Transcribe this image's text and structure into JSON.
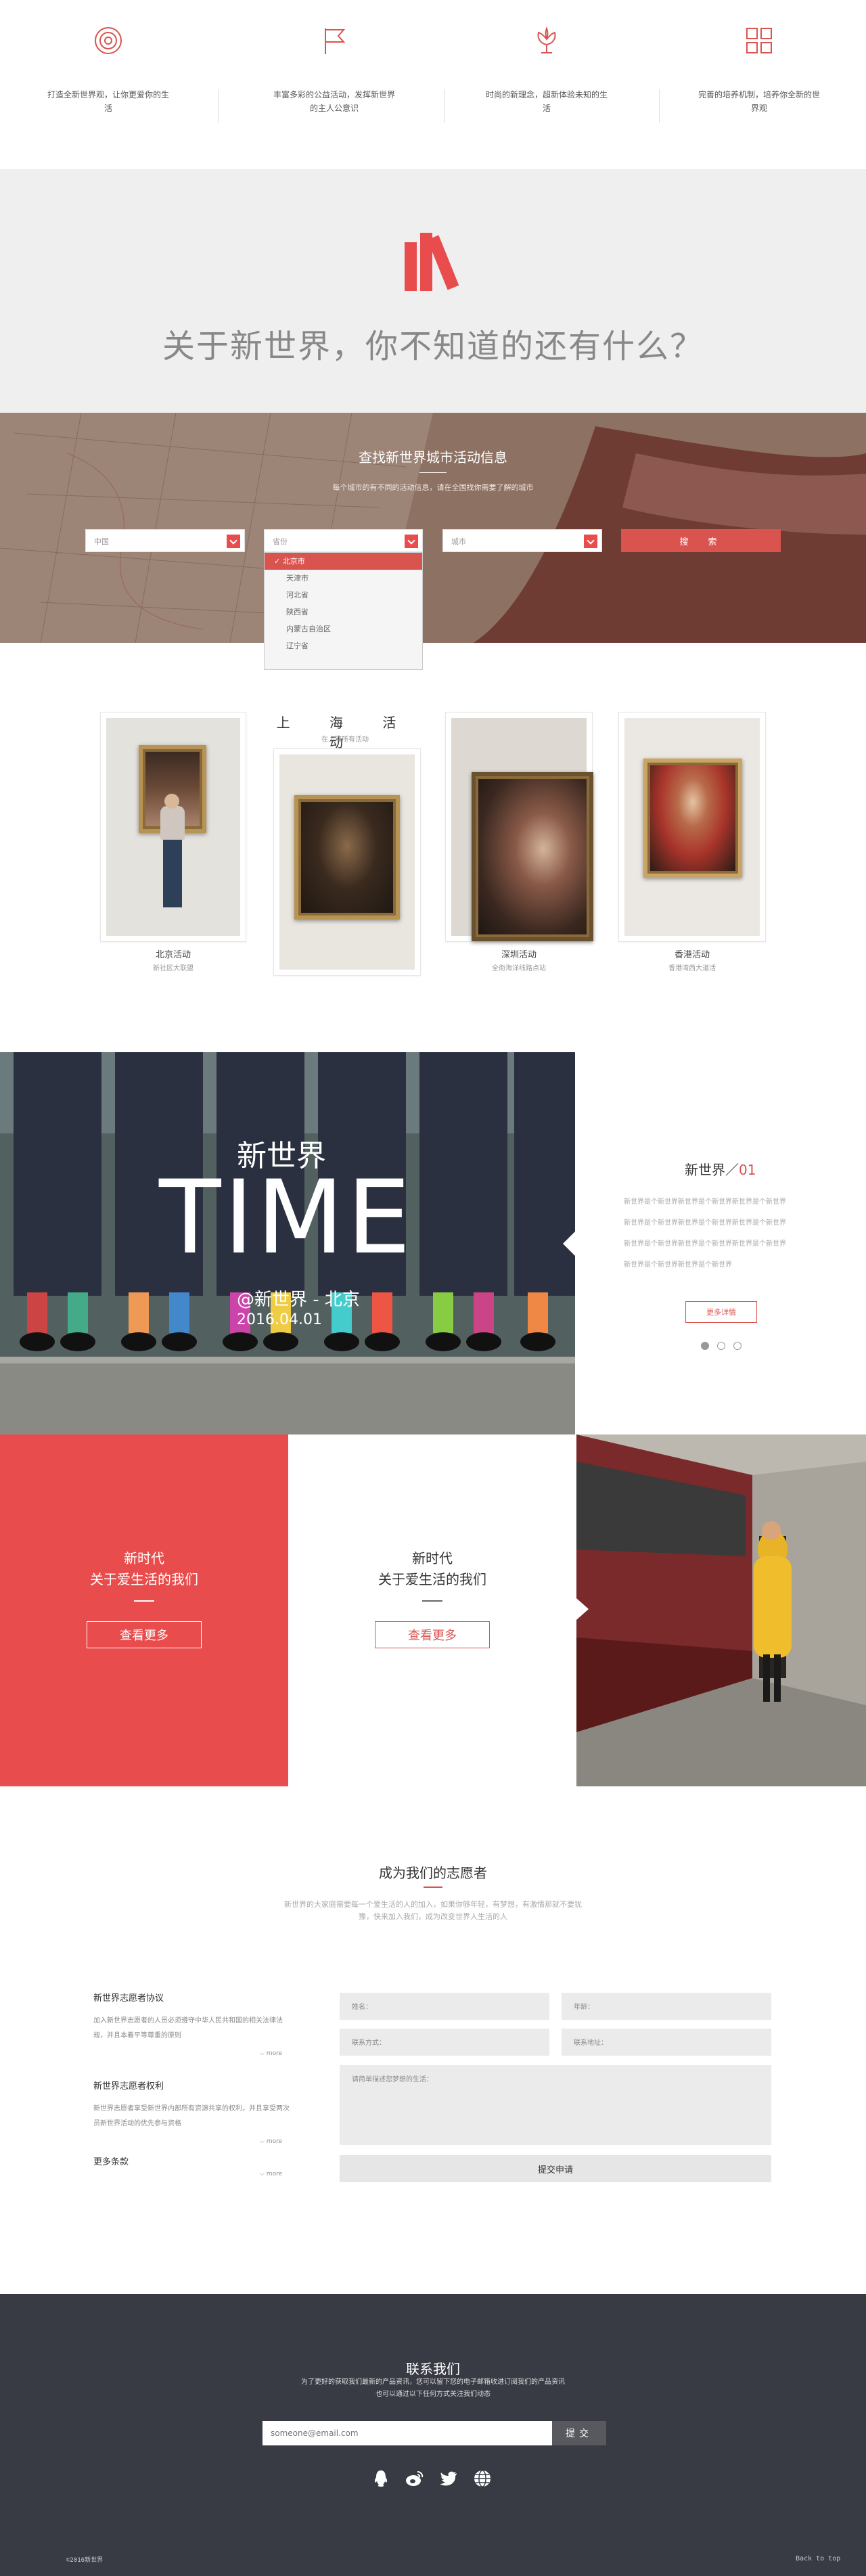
{
  "colors": {
    "accent": "#d9534f",
    "hero_bg": "#efefef",
    "footer_bg": "#383a44",
    "era_red": "#e84c4c"
  },
  "features": [
    {
      "icon": "target-icon",
      "text": "打造全新世界观，让你更爱你的生活"
    },
    {
      "icon": "flag-icon",
      "text": "丰富多彩的公益活动，发挥新世界的主人公意识"
    },
    {
      "icon": "lotus-icon",
      "text": "时尚的新理念，超新体验未知的生活"
    },
    {
      "icon": "grid-icon",
      "text": "完善的培养机制，培养你全新的世界观"
    }
  ],
  "about": {
    "icon": "books-icon",
    "title": "关于新世界，你不知道的还有什么？"
  },
  "search": {
    "title": "查找新世界城市活动信息",
    "subtitle": "每个城市的有不同的活动信息，请在全国找你需要了解的城市",
    "country": "中国",
    "province": "省份",
    "city": "城市",
    "button": "搜　索",
    "dropdown": [
      "北京市",
      "天津市",
      "河北省",
      "陕西省",
      "内蒙古自治区",
      "辽宁省"
    ]
  },
  "activity": {
    "title": "上 海 活 动",
    "subtitle": "在上海所有活动",
    "cards": [
      {
        "name": "北京活动",
        "place": "新社区大联盟"
      },
      {
        "name": "深圳活动",
        "place": "全街海洋线路点站"
      },
      {
        "name": "香港活动",
        "place": "香港湾西大道活"
      }
    ]
  },
  "time": {
    "small": "新世界",
    "big": "TIME",
    "location": "@新世界 - 北京",
    "date": "2016.04.01",
    "panel_title": "新世界／",
    "panel_num": "01",
    "panel_text": [
      "新世界是个新世界新世界是个新世界新世界是个新世界",
      "新世界是个新世界新世界是个新世界新世界是个新世界",
      "新世界是个新世界新世界是个新世界新世界是个新世界",
      "新世界是个新世界新世界是个新世界"
    ],
    "more": "更多详情"
  },
  "era": {
    "red": {
      "l1": "新时代",
      "l2": "关于爱生活的我们",
      "btn": "查看更多"
    },
    "white": {
      "l1": "新时代",
      "l2": "关于爱生活的我们",
      "btn": "查看更多"
    }
  },
  "volunteer": {
    "title": "成为我们的志愿者",
    "subtitle": "新世界的大家庭需要每一个爱生活的人的加入，如果你够年轻，有梦想，有激情那就不要犹豫，快来加入我们，成为改变世界人生活的人",
    "terms": [
      {
        "title": "新世界志愿者协议",
        "text": "加入新世界志愿者的人员必须遵守中华人民共和国的相关法律法规，并且本着平等尊重的原则",
        "more": "more"
      },
      {
        "title": "新世界志愿者权利",
        "text": "新世界志愿者享受新世界内部所有资源共享的权利，并且享受两次员新世界活动的优先参与资格",
        "more": "more"
      },
      {
        "title": "更多条款",
        "text": "",
        "more": "more"
      }
    ],
    "name": "姓名：",
    "age": "年龄：",
    "contact": "联系方式：",
    "address": "联系地址：",
    "message": "请简单描述您梦想的生活：",
    "submit": "提交申请"
  },
  "footer": {
    "title": "联系我们",
    "sub1": "为了更好的获取我们最新的产品资讯，您可以留下您的电子邮箱收进订阅我们的产品资讯",
    "sub2": "也可以通过以下任何方式关注我们动态",
    "email_placeholder": "someone@email.com",
    "send": "提交",
    "social": [
      "qq-icon",
      "weibo-icon",
      "twitter-icon",
      "globe-icon"
    ],
    "copyright": "©2016新世界",
    "back_to_top": "Back to top"
  }
}
